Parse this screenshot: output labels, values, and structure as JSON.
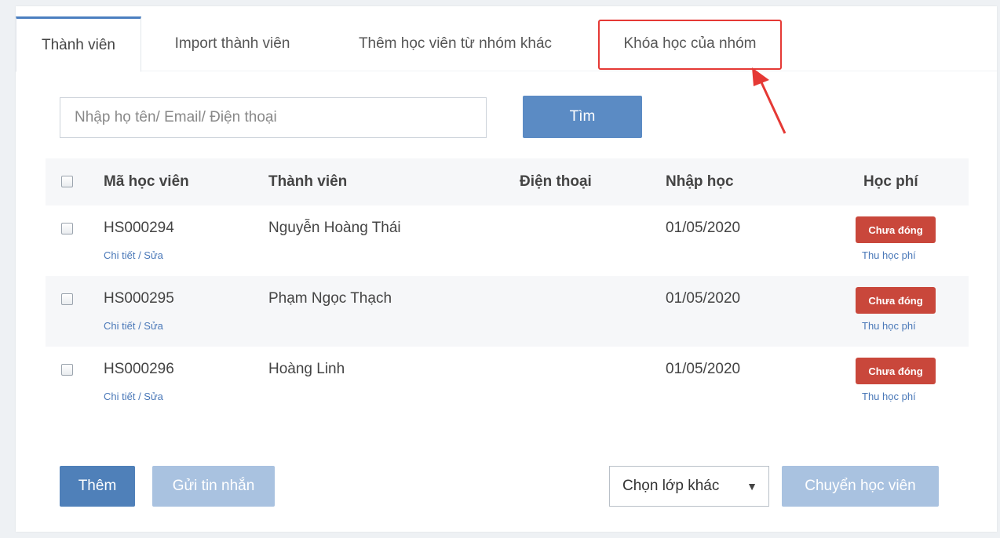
{
  "tabs": [
    {
      "label": "Thành viên",
      "active": true
    },
    {
      "label": "Import thành viên",
      "active": false
    },
    {
      "label": "Thêm học viên từ nhóm khác",
      "active": false
    },
    {
      "label": "Khóa học của nhóm",
      "active": false,
      "highlighted": true
    }
  ],
  "search": {
    "placeholder": "Nhập họ tên/ Email/ Điện thoại",
    "value": "",
    "button_label": "Tìm"
  },
  "table": {
    "columns": [
      "Mã học viên",
      "Thành viên",
      "Điện thoại",
      "Nhập học",
      "Học phí"
    ],
    "rows": [
      {
        "code": "HS000294",
        "detail_link": "Chi tiết / Sửa",
        "name": "Nguyễn Hoàng Thái",
        "phone": "",
        "enrolled": "01/05/2020",
        "fee_status": "Chưa đóng",
        "fee_link": "Thu học phí"
      },
      {
        "code": "HS000295",
        "detail_link": "Chi tiết / Sửa",
        "name": "Phạm Ngọc Thạch",
        "phone": "",
        "enrolled": "01/05/2020",
        "fee_status": "Chưa đóng",
        "fee_link": "Thu học phí"
      },
      {
        "code": "HS000296",
        "detail_link": "Chi tiết / Sửa",
        "name": "Hoàng Linh",
        "phone": "",
        "enrolled": "01/05/2020",
        "fee_status": "Chưa đóng",
        "fee_link": "Thu học phí"
      }
    ]
  },
  "footer": {
    "add_label": "Thêm",
    "message_label": "Gửi tin nhắn",
    "class_select": "Chọn lớp khác",
    "move_label": "Chuyển học viên"
  },
  "colors": {
    "accent": "#4f80b9",
    "highlight": "#e53935",
    "badge": "#c9473b"
  }
}
